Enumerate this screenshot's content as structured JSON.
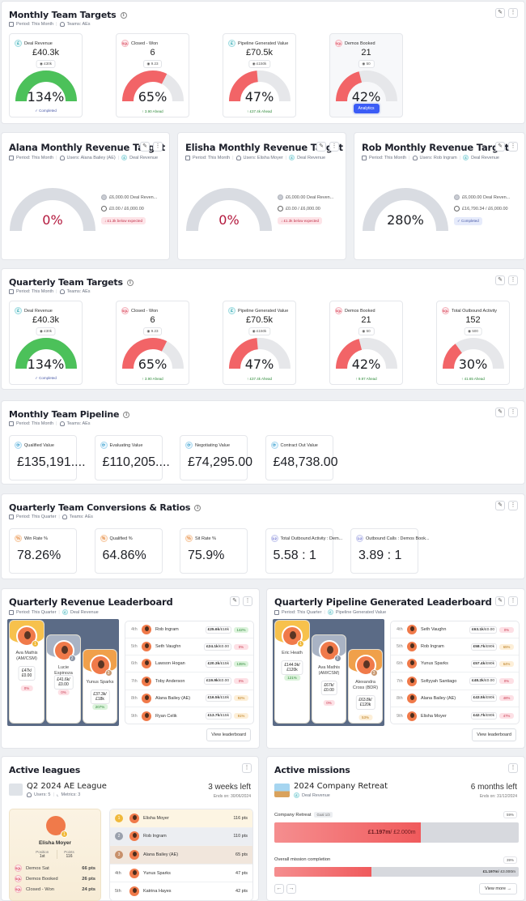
{
  "colors": {
    "green": "#4cc15a",
    "red": "#f26467",
    "track": "#e6e7ea",
    "gray_track": "#d9dce2",
    "accent_blue": "#3b5cf6",
    "dark_red": "#b3173c"
  },
  "toolbar": {
    "edit_icon": "✎",
    "more_icon": "⋮"
  },
  "monthly_targets": {
    "title": "Monthly Team Targets",
    "period": "Period: This Month",
    "teams": "Teams: AEs",
    "cards": [
      {
        "label": "Deal Revenue",
        "icon": "£",
        "icon_style": "teal",
        "value": "£40.3k",
        "target": "◉ £30k",
        "percent_label": "134%",
        "percent": 134,
        "footer": "✓ Completed",
        "footer_type": "done"
      },
      {
        "label": "Closed - Won",
        "icon": "SQL",
        "icon_style": "red",
        "value": "6",
        "target": "◉ 9.23",
        "percent_label": "65%",
        "percent": 65,
        "footer": "↑ 3.90 Ahead",
        "footer_type": "ahead"
      },
      {
        "label": "Pipeline Generated Value",
        "icon": "£",
        "icon_style": "teal",
        "value": "£70.5k",
        "target": "◉ £150k",
        "percent_label": "47%",
        "percent": 47,
        "footer": "↑ £37.4k Ahead",
        "footer_type": "ahead"
      },
      {
        "label": "Demos Booked",
        "icon": "SQL",
        "icon_style": "red",
        "value": "21",
        "target": "◉ 50",
        "percent_label": "42%",
        "percent": 42,
        "footer": "Analytics",
        "footer_type": "button"
      }
    ]
  },
  "user_targets": [
    {
      "title": "Alana Monthly Revenue Target",
      "period": "Period: This Month",
      "users": "Users: Alana Bailey (AE)",
      "metric": "Deal Revenue",
      "percent_label": "0%",
      "percent": 0,
      "target": "£6,000.00 Deal Reven...",
      "progress": "£0.00 / £6,000.00",
      "status": "↓ £1.3k below expected",
      "status_type": "bad"
    },
    {
      "title": "Elisha Monthly Revenue Target",
      "period": "Period: This Month",
      "users": "Users: Elisha Moyer",
      "metric": "Deal Revenue",
      "percent_label": "0%",
      "percent": 0,
      "target": "£6,000.00 Deal Reven...",
      "progress": "£0.00 / £6,000.00",
      "status": "↓ £1.3k below expected",
      "status_type": "bad"
    },
    {
      "title": "Rob Monthly Revenue Target",
      "period": "Period: This Month",
      "users": "Users: Rob Ingram",
      "metric": "Deal Revenue",
      "percent_label": "280%",
      "percent": 280,
      "target": "£6,000.00 Deal Reven...",
      "progress": "£16,790.34 / £6,000.00",
      "status": "✓ Completed",
      "status_type": "ok"
    }
  ],
  "quarterly_targets": {
    "title": "Quarterly Team Targets",
    "period": "Period: This Month",
    "teams": "Teams: AEs",
    "cards": [
      {
        "label": "Deal Revenue",
        "icon": "£",
        "icon_style": "teal",
        "value": "£40.3k",
        "target": "◉ £30k",
        "percent_label": "134%",
        "percent": 134,
        "footer": "✓ Completed",
        "footer_type": "done"
      },
      {
        "label": "Closed - Won",
        "icon": "SQL",
        "icon_style": "red",
        "value": "6",
        "target": "◉ 9.23",
        "percent_label": "65%",
        "percent": 65,
        "footer": "↑ 3.90 Ahead",
        "footer_type": "ahead"
      },
      {
        "label": "Pipeline Generated Value",
        "icon": "£",
        "icon_style": "teal",
        "value": "£70.5k",
        "target": "◉ £150k",
        "percent_label": "47%",
        "percent": 47,
        "footer": "↑ £37.4k Ahead",
        "footer_type": "ahead"
      },
      {
        "label": "Demos Booked",
        "icon": "SQL",
        "icon_style": "red",
        "value": "21",
        "target": "◉ 50",
        "percent_label": "42%",
        "percent": 42,
        "footer": "↑ 9.97 Ahead",
        "footer_type": "ahead"
      },
      {
        "label": "Total Outbound Activity",
        "icon": "SQL",
        "icon_style": "red",
        "value": "152",
        "target": "◉ 500",
        "percent_label": "30%",
        "percent": 30,
        "footer": "↑ 41.65 Ahead",
        "footer_type": "ahead"
      }
    ]
  },
  "pipeline": {
    "title": "Monthly Team Pipeline",
    "period": "Period: This Month",
    "teams": "Teams: AEs",
    "cards": [
      {
        "label": "Qualified Value",
        "value": "£135,191...."
      },
      {
        "label": "Evaluating Value",
        "value": "£110,205...."
      },
      {
        "label": "Negotiating Value",
        "value": "£74,295.00"
      },
      {
        "label": "Contract Out Value",
        "value": "£48,738.00"
      }
    ]
  },
  "conversions": {
    "title": "Quarterly Team Conversions & Ratios",
    "period": "Period: This Quarter",
    "teams": "Teams: AEs",
    "cards": [
      {
        "label": "Win Rate %",
        "icon": "%",
        "icon_style": "orange",
        "value": "78.26%"
      },
      {
        "label": "Qualified %",
        "icon": "%",
        "icon_style": "orange",
        "value": "64.86%"
      },
      {
        "label": "Sit Rate %",
        "icon": "%",
        "icon_style": "orange",
        "value": "75.9%"
      },
      {
        "label": "Total Outbound Activity : Dem...",
        "icon": "1:2",
        "icon_style": "purple",
        "value": "5.58 : 1"
      },
      {
        "label": "Outbound Calls : Demos Book...",
        "icon": "1:2",
        "icon_style": "purple",
        "value": "3.89 : 1"
      }
    ]
  },
  "revenue_leaderboard": {
    "title": "Quarterly Revenue Leaderboard",
    "period": "Period: This Quarter",
    "metric": "Deal Revenue",
    "podium": [
      {
        "rank": "1",
        "name": "Ava Mathis (AM/CSM)",
        "value": "£47k/£0.00",
        "percent": "0%",
        "pstyle": "red"
      },
      {
        "rank": "2",
        "name": "Lucie Espinoza",
        "value": "£41.6k/ £0.00",
        "percent": "0%",
        "pstyle": "red"
      },
      {
        "rank": "3",
        "name": "Yunus Sparks",
        "value": "£37.3k/ £18k",
        "percent": "207%",
        "pstyle": "green"
      }
    ],
    "rows": [
      {
        "rank": "4th",
        "name": "Rob Ingram",
        "value": "£25.6k",
        "target": "/£18k",
        "percent": "142%",
        "pstyle": "green"
      },
      {
        "rank": "5th",
        "name": "Seth Vaughn",
        "value": "£24.1k",
        "target": "/£0.00",
        "percent": "0%",
        "pstyle": "red"
      },
      {
        "rank": "6th",
        "name": "Lawson Hogan",
        "value": "£20.3k",
        "target": "/£15k",
        "percent": "135%",
        "pstyle": "green"
      },
      {
        "rank": "7th",
        "name": "Toby Anderson",
        "value": "£19.9k",
        "target": "/£0.00",
        "percent": "0%",
        "pstyle": "red"
      },
      {
        "rank": "8th",
        "name": "Alana Bailey (AE)",
        "value": "£16.5k",
        "target": "/£18k",
        "percent": "92%",
        "pstyle": "amber"
      },
      {
        "rank": "9th",
        "name": "Ryan Celik",
        "value": "£13.7k",
        "target": "/£15k",
        "percent": "91%",
        "pstyle": "amber"
      }
    ],
    "view_label": "View leaderboard"
  },
  "pipeline_leaderboard": {
    "title": "Quarterly Pipeline Generated Leaderboard",
    "period": "Period: This Quarter",
    "metric": "Pipeline Generated Value",
    "podium": [
      {
        "rank": "1",
        "name": "Eric Heath",
        "value": "£144.9k/ £120k",
        "percent": "121%",
        "pstyle": "green"
      },
      {
        "rank": "2",
        "name": "Ava Mathis (AM/CSM)",
        "value": "£67k/£0.00",
        "percent": "0%",
        "pstyle": "red"
      },
      {
        "rank": "3",
        "name": "Alexandra Cross (BDR)",
        "value": "£63.8k/ £120k",
        "percent": "53%",
        "pstyle": "amber"
      }
    ],
    "rows": [
      {
        "rank": "4th",
        "name": "Seth Vaughn",
        "value": "£63.1k",
        "target": "/£0.00",
        "percent": "0%",
        "pstyle": "red"
      },
      {
        "rank": "5th",
        "name": "Rob Ingram",
        "value": "£58.7k",
        "target": "/£90k",
        "percent": "65%",
        "pstyle": "amber"
      },
      {
        "rank": "6th",
        "name": "Yunus Sparks",
        "value": "£57.4k",
        "target": "/£90k",
        "percent": "64%",
        "pstyle": "amber"
      },
      {
        "rank": "7th",
        "name": "Sofiyyah Santiago",
        "value": "£48.2k",
        "target": "/£0.00",
        "percent": "0%",
        "pstyle": "red"
      },
      {
        "rank": "8th",
        "name": "Alana Bailey (AE)",
        "value": "£43.5k",
        "target": "/£90k",
        "percent": "48%",
        "pstyle": "red"
      },
      {
        "rank": "9th",
        "name": "Elisha Moyer",
        "value": "£42.7k",
        "target": "/£90k",
        "percent": "47%",
        "pstyle": "red"
      }
    ],
    "view_label": "View leaderboard"
  },
  "leagues": {
    "title": "Active leagues",
    "name": "Q2 2024 AE League",
    "users": "Users: 5",
    "metrics": "Metrics: 3",
    "time_left": "3 weeks left",
    "ends": "Ends on: 30/06/2024",
    "leader": {
      "name": "Elisha Moyer",
      "position_label": "Position",
      "position": "1st",
      "points_label": "Points",
      "points": "116",
      "metrics": [
        {
          "icon": "SQL",
          "name": "Demos Sat",
          "pts": "66 pts"
        },
        {
          "icon": "SQL",
          "name": "Demos Booked",
          "pts": "26 pts"
        },
        {
          "icon": "SQL",
          "name": "Closed - Won",
          "pts": "24 pts"
        }
      ]
    },
    "rows": [
      {
        "rank": "1",
        "name": "Elisha Moyer",
        "pts": "116 pts",
        "medal": "gold"
      },
      {
        "rank": "2",
        "name": "Rob Ingram",
        "pts": "110 pts",
        "medal": "silver"
      },
      {
        "rank": "3",
        "name": "Alana Bailey (AE)",
        "pts": "65 pts",
        "medal": "bronze"
      },
      {
        "rank": "4th",
        "name": "Yunus Sparks",
        "pts": "47 pts",
        "medal": ""
      },
      {
        "rank": "5th",
        "name": "Katrina Hayes",
        "pts": "42 pts",
        "medal": ""
      }
    ]
  },
  "missions": {
    "title": "Active missions",
    "name": "2024 Company Retreat",
    "metric": "Deal Revenue",
    "time_left": "6 months left",
    "ends": "Ends on: 31/12/2024",
    "goal_label": "Company Retreat",
    "goal_chip": "Goal 1/3",
    "goal_pct": "59%",
    "goal_progress": 0.598,
    "goal_value": "£1.197m",
    "goal_target": " / £2.000m",
    "overall_label": "Overall mission completion",
    "overall_pct": "39%",
    "overall_progress": 0.399,
    "overall_value": "£1.197m",
    "overall_target": " / £3.000m",
    "prev": "←",
    "next": "→",
    "view_more": "View more  →"
  }
}
